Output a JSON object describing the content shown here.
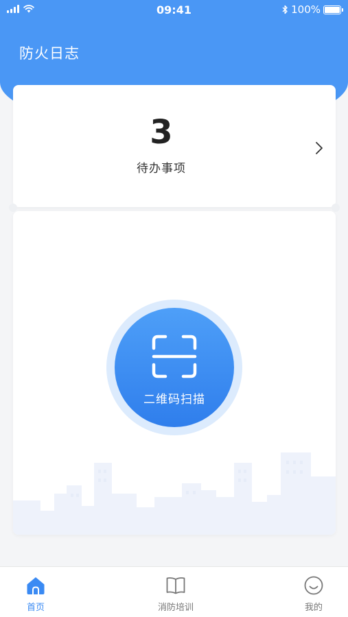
{
  "status_bar": {
    "time": "09:41",
    "battery": "100%",
    "icons": [
      "signal-icon",
      "wifi-icon",
      "bluetooth-icon",
      "battery-icon"
    ]
  },
  "header": {
    "title": "防火日志"
  },
  "todo": {
    "count": "3",
    "label": "待办事项",
    "icon": "chevron-right-icon"
  },
  "scan": {
    "label": "二维码扫描",
    "icon": "qr-scan-icon"
  },
  "tabs": [
    {
      "label": "首页",
      "icon": "home-icon",
      "active": true
    },
    {
      "label": "消防培训",
      "icon": "book-icon",
      "active": false
    },
    {
      "label": "我的",
      "icon": "smiley-icon",
      "active": false
    }
  ],
  "colors": {
    "primary": "#4a97f5",
    "active_tab": "#3a8af3",
    "inactive_tab": "#777777",
    "background": "#f4f5f7"
  }
}
